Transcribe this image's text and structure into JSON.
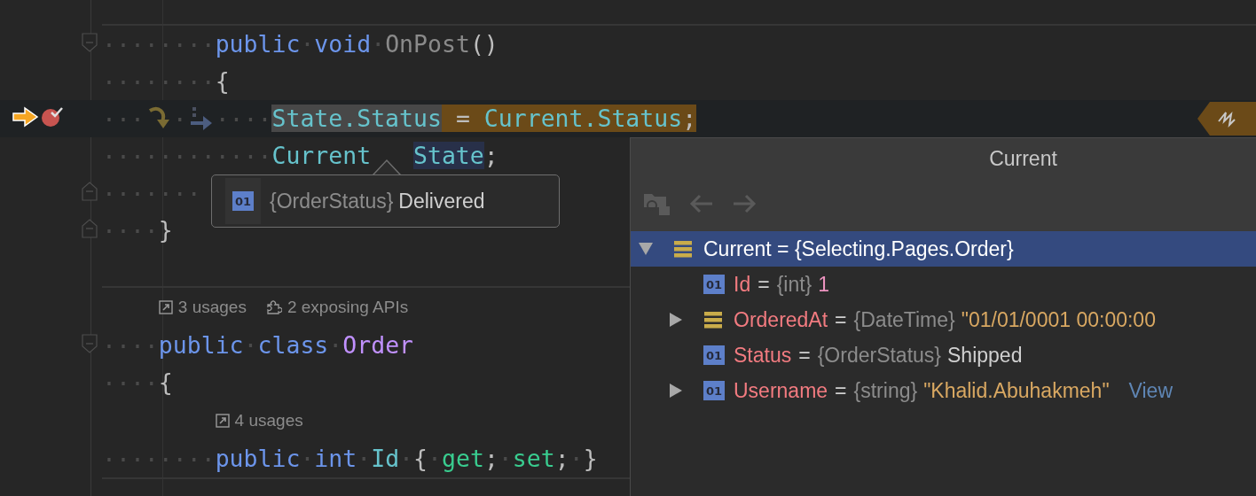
{
  "editor": {
    "lines": [
      {
        "kind": "separator"
      },
      {
        "kind": "code",
        "fold": {
          "kind": "start"
        },
        "tokens": [
          {
            "kind": "ws",
            "text": "········"
          },
          {
            "kind": "kw",
            "text": "public"
          },
          {
            "kind": "ws",
            "text": "·"
          },
          {
            "kind": "kw",
            "text": "void"
          },
          {
            "kind": "ws",
            "text": "·"
          },
          {
            "kind": "method",
            "text": "OnPost"
          },
          {
            "kind": "punct",
            "text": "()"
          }
        ]
      },
      {
        "kind": "code",
        "tokens": [
          {
            "kind": "ws",
            "text": "········"
          },
          {
            "kind": "punct",
            "text": "{"
          }
        ]
      },
      {
        "kind": "code",
        "current": true,
        "breakpoint": true,
        "end_marker": true,
        "tokens": [
          {
            "kind": "ws",
            "text": "···"
          },
          {
            "kind": "step_over"
          },
          {
            "kind": "ws",
            "text": "·"
          },
          {
            "kind": "step_into"
          },
          {
            "kind": "ws",
            "text": "····"
          },
          {
            "kind": "prop",
            "text": "State.Status",
            "highlight": {
              "kind": "selection"
            }
          },
          {
            "kind": "punct",
            "text": " = ",
            "highlight": {
              "kind": "evaluated"
            }
          },
          {
            "kind": "prop",
            "text": "Current.Status",
            "highlight": {
              "kind": "evaluated"
            }
          },
          {
            "kind": "punct",
            "text": ";",
            "highlight": {
              "kind": "evaluated"
            }
          }
        ]
      },
      {
        "kind": "code",
        "tokens": [
          {
            "kind": "ws",
            "text": "············"
          },
          {
            "kind": "prop",
            "text": "Current"
          },
          {
            "kind": "covered"
          },
          {
            "kind": "prop",
            "text": "State",
            "highlight": {
              "kind": "usage"
            }
          },
          {
            "kind": "punct",
            "text": ";"
          }
        ]
      },
      {
        "kind": "code",
        "fold": {
          "kind": "end"
        },
        "tokens": [
          {
            "kind": "ws",
            "text": "·······"
          }
        ]
      },
      {
        "kind": "code",
        "fold": {
          "kind": "end"
        },
        "tokens": [
          {
            "kind": "ws",
            "text": "····"
          },
          {
            "kind": "punct",
            "text": "}"
          }
        ]
      },
      {
        "kind": "blank"
      },
      {
        "kind": "separator"
      },
      {
        "kind": "hint",
        "items": [
          {
            "kind": "usages",
            "text": "3 usages"
          },
          {
            "kind": "apis",
            "text": "2 exposing APIs"
          }
        ]
      },
      {
        "kind": "code",
        "fold": {
          "kind": "start"
        },
        "tokens": [
          {
            "kind": "ws",
            "text": "····"
          },
          {
            "kind": "kw",
            "text": "public"
          },
          {
            "kind": "ws",
            "text": "·"
          },
          {
            "kind": "kw",
            "text": "class"
          },
          {
            "kind": "ws",
            "text": "·"
          },
          {
            "kind": "type",
            "text": "Order"
          }
        ]
      },
      {
        "kind": "code",
        "tokens": [
          {
            "kind": "ws",
            "text": "····"
          },
          {
            "kind": "punct",
            "text": "{"
          }
        ]
      },
      {
        "kind": "hint",
        "items": [
          {
            "kind": "usages",
            "text": "4 usages"
          }
        ]
      },
      {
        "kind": "code",
        "tokens": [
          {
            "kind": "ws",
            "text": "········"
          },
          {
            "kind": "kw",
            "text": "public"
          },
          {
            "kind": "ws",
            "text": "·"
          },
          {
            "kind": "kw",
            "text": "int"
          },
          {
            "kind": "ws",
            "text": "·"
          },
          {
            "kind": "prop",
            "text": "Id"
          },
          {
            "kind": "ws",
            "text": "·"
          },
          {
            "kind": "punct",
            "text": "{"
          },
          {
            "kind": "ws",
            "text": "·"
          },
          {
            "kind": "accessor",
            "text": "get"
          },
          {
            "kind": "punct",
            "text": ";"
          },
          {
            "kind": "ws",
            "text": "·"
          },
          {
            "kind": "accessor",
            "text": "set"
          },
          {
            "kind": "punct",
            "text": ";"
          },
          {
            "kind": "ws",
            "text": "·"
          },
          {
            "kind": "punct",
            "text": "}"
          }
        ]
      },
      {
        "kind": "separator"
      }
    ]
  },
  "tooltip": {
    "badge": "01",
    "type": "{OrderStatus}",
    "value": "Delivered"
  },
  "popup": {
    "title": "Current",
    "toolbar": [
      {
        "kind": "evaluate",
        "disabled": true
      },
      {
        "kind": "back",
        "disabled": true
      },
      {
        "kind": "forward",
        "disabled": true
      }
    ],
    "tree": [
      {
        "kind": "object",
        "selected": true,
        "expanded": true,
        "label": "Current = {Selecting.Pages.Order}",
        "children": [
          {
            "kind": "field",
            "selected": false,
            "badge": "01",
            "name": "Id",
            "op": "=",
            "type": "{int}",
            "value": {
              "kind": "number",
              "text": "1"
            }
          },
          {
            "kind": "object",
            "selected": false,
            "expanded": false,
            "name": "OrderedAt",
            "op": "=",
            "type": "{DateTime}",
            "value": {
              "kind": "string",
              "text": "\"01/01/0001 00:00:00"
            }
          },
          {
            "kind": "field",
            "selected": false,
            "badge": "01",
            "name": "Status",
            "op": "=",
            "type": "{OrderStatus}",
            "value": {
              "kind": "enum",
              "text": "Shipped"
            }
          },
          {
            "kind": "field",
            "selected": false,
            "expanded": false,
            "badge": "01",
            "name": "Username",
            "op": "=",
            "type": "{string}",
            "value": {
              "kind": "string",
              "text": "\"Khalid.Abuhakmeh\""
            },
            "link": "View"
          }
        ]
      }
    ]
  }
}
